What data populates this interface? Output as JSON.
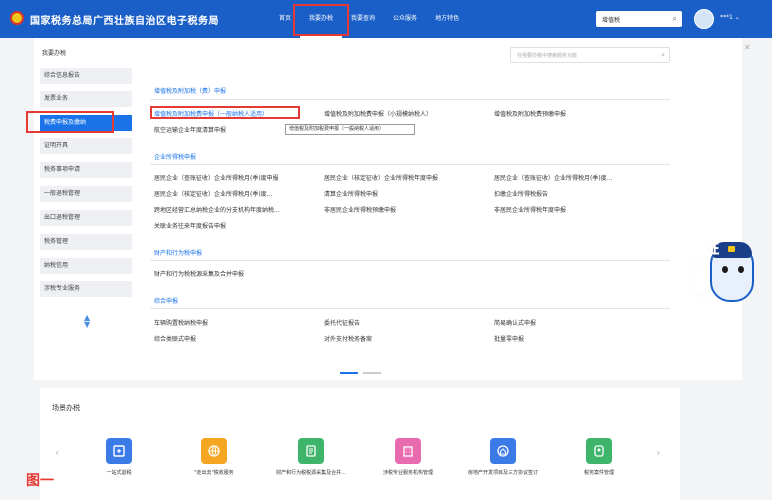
{
  "header": {
    "site_title": "国家税务总局广西壮族自治区电子税务局",
    "nav": [
      "首页",
      "我要办税",
      "我要查询",
      "公众服务",
      "地方特色"
    ],
    "search_value": "增值税",
    "user_name": "***1 ⌄"
  },
  "sidebar": {
    "title": "我要办税",
    "items": [
      "综合信息报告",
      "发票业务",
      "税费申报及缴纳",
      "证明开具",
      "税务事项申请",
      "一般退税管理",
      "出口退税管理",
      "税务管理",
      "纳税信用",
      "涉税专业服务"
    ]
  },
  "content": {
    "search_placeholder": "在我要办税中搜索服务功能",
    "sections": [
      {
        "title": "增值税及附加税（费）申报",
        "links": [
          "增值税及附加税费申报（一般纳税人适用）",
          "增值税及附加税费申报（小规模纳税人）",
          "增值税及附加税费预缴申报",
          "航空运输企业年度清算申报"
        ]
      },
      {
        "title": "企业所得税申报",
        "links": [
          "居民企业（查账征收）企业所得税月(季)度申报",
          "居民企业（核定征收）企业所得税年度申报",
          "居民企业（查账征收）企业所得税月(季)度...",
          "居民企业（核定征收）企业所得税月(季)度...",
          "清算企业所得税申报",
          "扣缴企业所得税报告",
          "跨地区经营汇总纳税企业的分支机构年度纳税...",
          "非居民企业所得税预缴申报",
          "非居民企业所得税年度申报",
          "关联业务往来年度报告申报"
        ]
      },
      {
        "title": "财产和行为税申报",
        "links": [
          "财产和行为税税源采集及合并申报"
        ]
      },
      {
        "title": "综合申报",
        "links": [
          "车辆购置税纳税申报",
          "委托代征报告",
          "简易确认式申报",
          "综合类联式申报",
          "对外支付税务备案",
          "批量零申报"
        ]
      }
    ],
    "tooltip": "增值税及附加税费申报（一般纳税人适用）"
  },
  "mascot": {
    "chars": [
      "征",
      "纳",
      "互",
      "动"
    ]
  },
  "bottom": {
    "title": "场景办税",
    "tiles": [
      {
        "label": "一站式退税",
        "icon": "refund-icon",
        "color": "#3b7be8"
      },
      {
        "label": "\"走出去\"税收服务",
        "icon": "globe-icon",
        "color": "#f5a623"
      },
      {
        "label": "财产和行为税税源采集及合并...",
        "icon": "document-icon",
        "color": "#3fb56b"
      },
      {
        "label": "涉税专业服务机构管理",
        "icon": "building-icon",
        "color": "#e86bb0"
      },
      {
        "label": "房地产开发项目及三方协议签订",
        "icon": "house-icon",
        "color": "#3b7be8"
      },
      {
        "label": "税务案件管理",
        "icon": "case-icon",
        "color": "#3fb56b"
      }
    ],
    "figure_label": "图一"
  }
}
